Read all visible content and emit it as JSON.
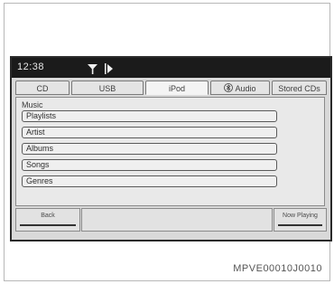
{
  "status": {
    "time": "12:38"
  },
  "tabs": [
    {
      "label": "CD",
      "active": false
    },
    {
      "label": "USB",
      "active": false
    },
    {
      "label": "iPod",
      "active": true
    },
    {
      "label": "Audio",
      "active": false
    },
    {
      "label": "Stored CDs",
      "active": false
    }
  ],
  "music": {
    "section_label": "Music",
    "items": [
      "Playlists",
      "Artist",
      "Albums",
      "Songs",
      "Genres"
    ]
  },
  "softkeys": {
    "left_label": "Back",
    "right_label": "Now Playing"
  },
  "caption": "MPVE00010J0010",
  "icons": {
    "audio_tab": "bluetooth-icon",
    "status": [
      "antenna-icon",
      "play-icon"
    ]
  },
  "colors": {
    "screen_bg": "#d9d9d9",
    "statusbar_bg": "#1b1b1b"
  }
}
